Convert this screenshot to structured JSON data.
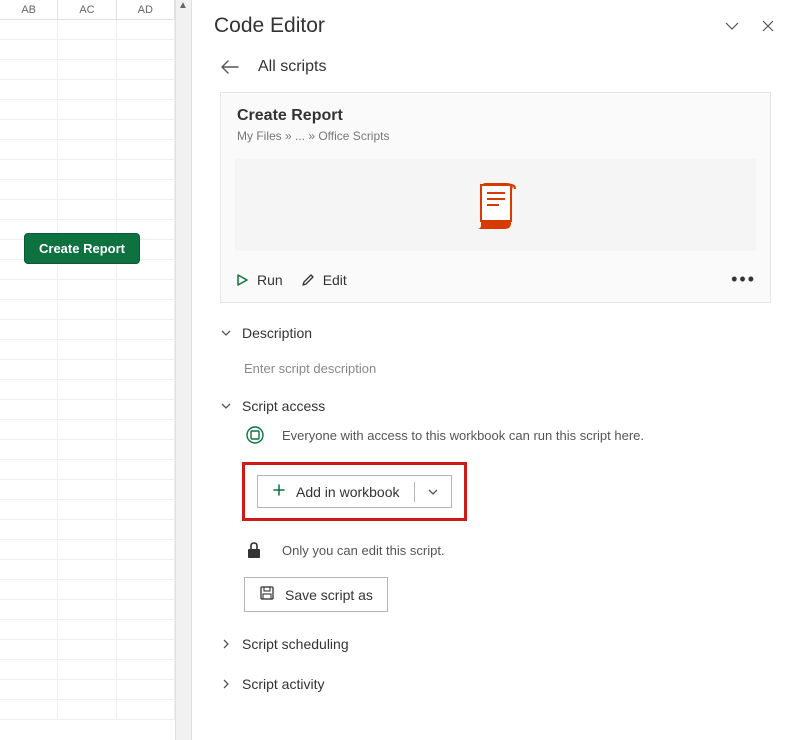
{
  "sheet": {
    "columns": [
      "AB",
      "AC",
      "AD"
    ],
    "button_label": "Create Report"
  },
  "editor": {
    "title": "Code Editor",
    "back_label": "All scripts",
    "script": {
      "name": "Create Report",
      "breadcrumb": "My Files » ... » Office Scripts"
    },
    "actions": {
      "run": "Run",
      "edit": "Edit"
    },
    "sections": {
      "description": {
        "title": "Description",
        "placeholder": "Enter script description"
      },
      "script_access": {
        "title": "Script access",
        "everyone_text": "Everyone with access to this workbook can run this script here.",
        "add_button": "Add in workbook",
        "only_you_text": "Only you can edit this script.",
        "save_as": "Save script as"
      },
      "scheduling": {
        "title": "Script scheduling"
      },
      "activity": {
        "title": "Script activity"
      }
    }
  },
  "colors": {
    "green_accent": "#0d7240",
    "script_icon": "#d83b01",
    "highlight": "#d01a1a"
  }
}
